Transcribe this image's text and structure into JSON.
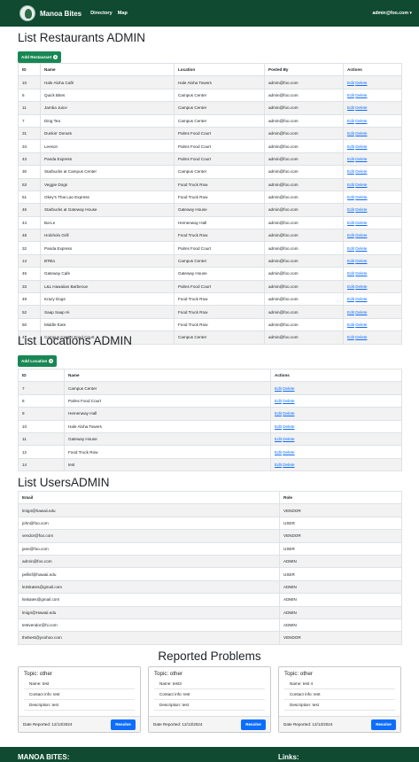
{
  "navbar": {
    "brand": "Manoa Bites",
    "links": [
      "Directory",
      "Map"
    ],
    "user": "admin@foo.com ▾"
  },
  "restaurants": {
    "title": "List Restaurants ADMIN",
    "add_label": "Add Restaurant",
    "columns": [
      "ID",
      "Name",
      "Location",
      "Posted By",
      "Actions"
    ],
    "edit_label": "Edit",
    "delete_label": "Delete",
    "rows": [
      [
        "10",
        "Hale Aloha Café",
        "Hale Aloha Towers",
        "admin@foo.com"
      ],
      [
        "6",
        "Quick Bites",
        "Campus Center",
        "admin@foo.com"
      ],
      [
        "11",
        "Jamba Juice",
        "Campus Center",
        "admin@foo.com"
      ],
      [
        "7",
        "Ding Tea",
        "Campus Center",
        "admin@foo.com"
      ],
      [
        "31",
        "Dunkin' Donuts",
        "Palms Food Court",
        "admin@foo.com"
      ],
      [
        "34",
        "Leeson",
        "Palms Food Court",
        "admin@foo.com"
      ],
      [
        "43",
        "Panda Express",
        "Palms Food Court",
        "admin@foo.com"
      ],
      [
        "30",
        "Starbucks at Campus Center",
        "Campus Center",
        "admin@foo.com"
      ],
      [
        "53",
        "Veggie Dogs",
        "Food Truck Row",
        "admin@foo.com"
      ],
      [
        "51",
        "Okey's Thai Lao Express",
        "Food Truck Row",
        "admin@foo.com"
      ],
      [
        "46",
        "Starbucks at Gateway House",
        "Gateway House",
        "admin@foo.com"
      ],
      [
        "44",
        "Ba-Le",
        "Hemenway Hall",
        "admin@foo.com"
      ],
      [
        "48",
        "Holoholo Grill",
        "Food Truck Row",
        "admin@foo.com"
      ],
      [
        "32",
        "Panda Express",
        "Palms Food Court",
        "admin@foo.com"
      ],
      [
        "14",
        "B'Rito",
        "Campus Center",
        "admin@foo.com"
      ],
      [
        "45",
        "Gateway Cafe",
        "Gateway House",
        "admin@foo.com"
      ],
      [
        "33",
        "L&L Hawaiian Barbecue",
        "Palms Food Court",
        "admin@foo.com"
      ],
      [
        "49",
        "Krazy Dogs",
        "Food Truck Row",
        "admin@foo.com"
      ],
      [
        "52",
        "Saap Saap Hi",
        "Food Truck Row",
        "admin@foo.com"
      ],
      [
        "50",
        "Middle Eats",
        "Food Truck Row",
        "admin@foo.com"
      ],
      [
        "47",
        "Campus Center Food Court",
        "Campus Center",
        "admin@foo.com"
      ]
    ]
  },
  "locations": {
    "title": "List Locations ADMIN",
    "add_label": "Add Location",
    "columns": [
      "ID",
      "Name",
      "Actions"
    ],
    "edit_label": "Edit",
    "delete_label": "Delete",
    "rows": [
      [
        "7",
        "Campus Center"
      ],
      [
        "8",
        "Palms Food Court"
      ],
      [
        "9",
        "Hemenway Hall"
      ],
      [
        "10",
        "Hale Aloha Towers"
      ],
      [
        "11",
        "Gateway House"
      ],
      [
        "12",
        "Food Truck Row"
      ],
      [
        "14",
        "test"
      ]
    ]
  },
  "users": {
    "title": "List UsersADMIN",
    "columns": [
      "Email",
      "Role"
    ],
    "rows": [
      [
        "lmig4@hawaii.edu",
        "VENDOR"
      ],
      [
        "john@foo.com",
        "USER"
      ],
      [
        "vendor@foo.com",
        "VENDOR"
      ],
      [
        "jane@foo.com",
        "USER"
      ],
      [
        "admin@foo.com",
        "ADMIN"
      ],
      [
        "pellisf@hawaii.edu",
        "USER"
      ],
      [
        "le2skates@gmail.com",
        "ADMIN"
      ],
      [
        "lsskates@gmail.com",
        "ADMIN"
      ],
      [
        "lmig4@Hawaii.edu",
        "ADMIN"
      ],
      [
        "testvendor@hi.com",
        "ADMIN"
      ],
      [
        "thebest@yoohoo.com",
        "VENDOR"
      ]
    ]
  },
  "problems": {
    "title": "Reported Problems",
    "resolve_label": "Resolve",
    "cards": [
      {
        "topic": "Topic: other",
        "name": "Name: test",
        "contact": "Contact info: test",
        "description": "Description: test",
        "date": "Date Reported: 12/13/2024"
      },
      {
        "topic": "Topic: other",
        "name": "Name: test3",
        "contact": "Contact info: test",
        "description": "Description: test",
        "date": "Date Reported: 12/13/2024"
      },
      {
        "topic": "Topic: other",
        "name": "Name: test 4",
        "contact": "Contact info: test",
        "description": "Description: test",
        "date": "Date Reported: 12/13/2024"
      }
    ]
  },
  "footer": {
    "left": "MANOA BITES:",
    "right": "Links:"
  }
}
